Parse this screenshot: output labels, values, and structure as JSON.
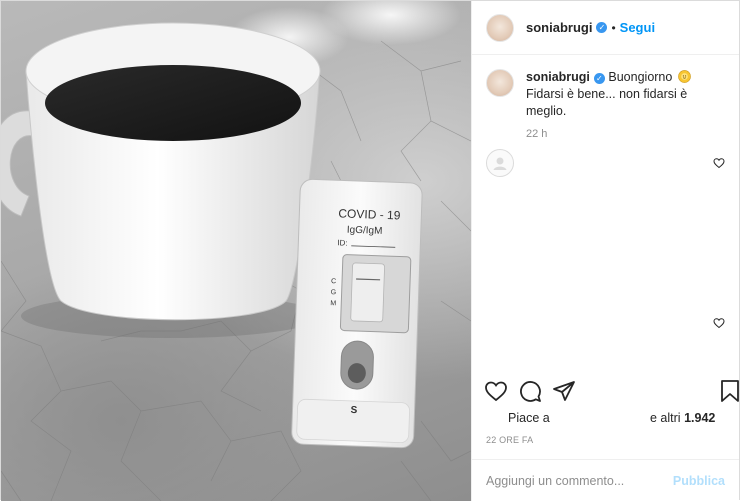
{
  "post": {
    "username": "soniabrugi",
    "separator": "•",
    "follow_label": "Segui",
    "caption_greeting": "Buongiorno",
    "caption_rest": "Fidarsi è bene... non fidarsi è meglio.",
    "caption_time": "22 h"
  },
  "photo": {
    "test_title": "COVID - 19",
    "test_subtitle": "IgG/IgM",
    "test_id": "ID:",
    "test_c": "C",
    "test_g": "G",
    "test_m": "M",
    "test_s": "S"
  },
  "likes": {
    "liked_by": "Piace a",
    "others_prefix": "e altri",
    "count": "1.942"
  },
  "post_date": "22 ORE FA",
  "comment_input": {
    "placeholder": "Aggiungi un commento...",
    "publish_label": "Pubblica"
  },
  "icons": {
    "verified": "verified-badge-icon",
    "like": "heart-outline-icon",
    "comment": "speech-bubble-icon",
    "share": "paper-plane-icon",
    "save": "bookmark-icon",
    "emoji": "sun-emoji-icon"
  },
  "colors": {
    "accent": "#0095f6",
    "verified": "#3897f0",
    "secondary_text": "#8e8e8e",
    "publish_disabled": "#b2dffc"
  }
}
